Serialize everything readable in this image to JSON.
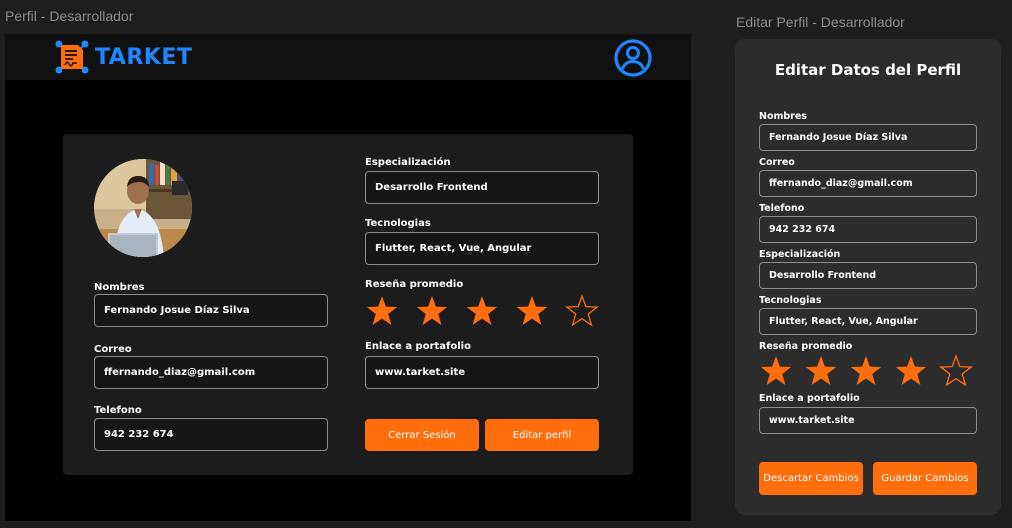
{
  "frames": {
    "profile_label": "Perfil - Desarrollador",
    "edit_label": "Editar Perfil - Desarrollador"
  },
  "brand": {
    "name": "TARKET",
    "color": "#1e87ff",
    "accent": "#ff6d0d"
  },
  "icons": {
    "logo": "document-logo-icon",
    "user": "user-circle-icon",
    "star": "star-icon"
  },
  "profile": {
    "fields": {
      "nombres": {
        "label": "Nombres",
        "value": "Fernando Josue Díaz Silva"
      },
      "correo": {
        "label": "Correo",
        "value": "ffernando_diaz@gmail.com"
      },
      "telefono": {
        "label": "Telefono",
        "value": "942 232 674"
      },
      "especializacion": {
        "label": "Especialización",
        "value": "Desarrollo Frontend"
      },
      "tecnologias": {
        "label": "Tecnologias",
        "value": "Flutter, React, Vue, Angular"
      },
      "portafolio": {
        "label": "Enlace a portafolio",
        "value": "www.tarket.site"
      }
    },
    "rating": {
      "label": "Reseña promedio",
      "value": 4,
      "max": 5
    },
    "buttons": {
      "logout": "Cerrar Sesión",
      "edit": "Editar perfil"
    }
  },
  "edit_panel": {
    "title": "Editar Datos del Perfil",
    "fields": {
      "nombres": {
        "label": "Nombres",
        "value": "Fernando Josue Díaz Silva"
      },
      "correo": {
        "label": "Correo",
        "value": "ffernando_diaz@gmail.com"
      },
      "telefono": {
        "label": "Telefono",
        "value": "942 232 674"
      },
      "especializacion": {
        "label": "Especialización",
        "value": "Desarrollo Frontend"
      },
      "tecnologias": {
        "label": "Tecnologias",
        "value": "Flutter, React, Vue, Angular"
      },
      "portafolio": {
        "label": "Enlace a portafolio",
        "value": "www.tarket.site"
      }
    },
    "rating": {
      "label": "Reseña promedio",
      "value": 4,
      "max": 5
    },
    "buttons": {
      "discard": "Descartar Cambios",
      "save": "Guardar Cambios"
    }
  }
}
